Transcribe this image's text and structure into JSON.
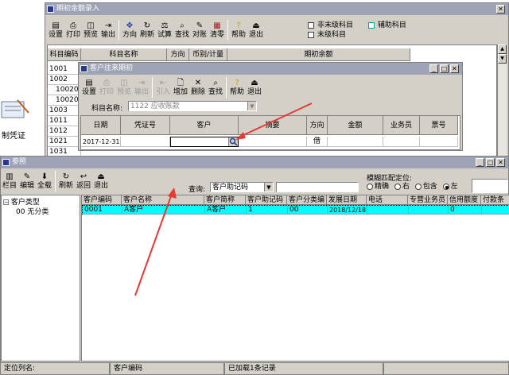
{
  "colors": {
    "title_bar": "#9ea3b6",
    "selected_row": "#00ffff",
    "arrow": "#e53935"
  },
  "bg_window": {
    "title": "期初余额录入",
    "toolbar": [
      "设置",
      "打印",
      "预览",
      "输出",
      "方向",
      "刷新",
      "试算",
      "查找",
      "对账",
      "清零",
      "帮助",
      "退出"
    ],
    "legend": {
      "non_leaf": "非末级科目",
      "aux": "辅助科目",
      "leaf": "末级科目"
    },
    "columns": [
      "科目编码",
      "科目名称",
      "方向",
      "币别/计量",
      "期初余额"
    ],
    "codes": [
      "1001",
      "1002",
      "100201",
      "100202",
      "1003",
      "1011",
      "1012",
      "1021",
      "1031"
    ]
  },
  "left_fragment": {
    "label": "制凭证"
  },
  "dialog": {
    "title": "客户往来期初",
    "toolbar": [
      "设置",
      "打印",
      "预览",
      "输出",
      "引入",
      "增加",
      "删除",
      "查找",
      "帮助",
      "退出"
    ],
    "subject_label": "科目名称:",
    "subject_value": "1122 应收账款",
    "columns": [
      "日期",
      "凭证号",
      "客户",
      "摘要",
      "方向",
      "金额",
      "业务员",
      "票号"
    ],
    "row": {
      "date": "2017-12-31",
      "direction": "借"
    }
  },
  "ref_window": {
    "title": "参照",
    "toolbar": [
      "栏目",
      "编辑",
      "全载",
      "刷新",
      "返回",
      "退出"
    ],
    "query_label": "查询:",
    "query_value": "客户助记码",
    "fuzzy_label": "模糊匹配定位:",
    "fuzzy_options": [
      "精确",
      "右",
      "包含",
      "左"
    ],
    "fuzzy_selected": "左",
    "tree": {
      "root": "客户类型",
      "child": "00 无分类"
    },
    "columns": [
      "客户编码",
      "客户名称",
      "客户简称",
      "客户助记码",
      "客户分类编",
      "发展日期",
      "电话",
      "专营业务员",
      "信用额度",
      "付款条"
    ],
    "rows": [
      {
        "code": "0001",
        "name": "A客户",
        "short": "A客户",
        "mnemonic": "1",
        "category": "00",
        "date": "2018/12/18",
        "phone": "",
        "salesman": "",
        "credit": "0",
        "payment": ""
      }
    ]
  },
  "status_bar": {
    "locate_label": "定位列名:",
    "column_name": "客户编码",
    "loaded": "已加载1条记录"
  }
}
